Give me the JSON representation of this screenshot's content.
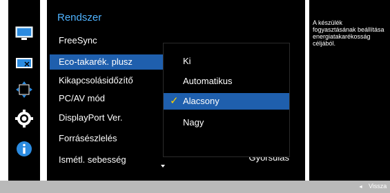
{
  "menu": {
    "title": "Rendszer",
    "items": [
      {
        "label": "FreeSync",
        "selected": false
      },
      {
        "label": "Eco-takarék. plusz",
        "selected": true
      },
      {
        "label": "Kikapcsolásidőzítő",
        "selected": false
      },
      {
        "label": "PC/AV mód",
        "selected": false
      },
      {
        "label": "DisplayPort Ver.",
        "selected": false
      },
      {
        "label": "Forrásészlelés",
        "selected": false
      },
      {
        "label": "Ismétl. sebesség",
        "selected": false
      }
    ],
    "value": "Gyorsulás"
  },
  "submenu": {
    "options": [
      {
        "label": "Ki",
        "selected": false
      },
      {
        "label": "Automatikus",
        "selected": false
      },
      {
        "label": "Alacsony",
        "selected": true
      },
      {
        "label": "Nagy",
        "selected": false
      }
    ],
    "check_glyph": "✓"
  },
  "info": {
    "text": "A készülék\nfogyasztásának beállítása\nenergiatakarékosság\ncéljából."
  },
  "footer": {
    "back_label": "Vissza",
    "back_arrow": "◄"
  },
  "icons": [
    "picture-icon",
    "color-icon",
    "size-position-icon",
    "settings-gear-icon",
    "info-icon"
  ],
  "colors": {
    "accent_title": "#4fb3ff",
    "selection": "#1f5fad",
    "check": "#ffd400",
    "background": "#000000"
  }
}
